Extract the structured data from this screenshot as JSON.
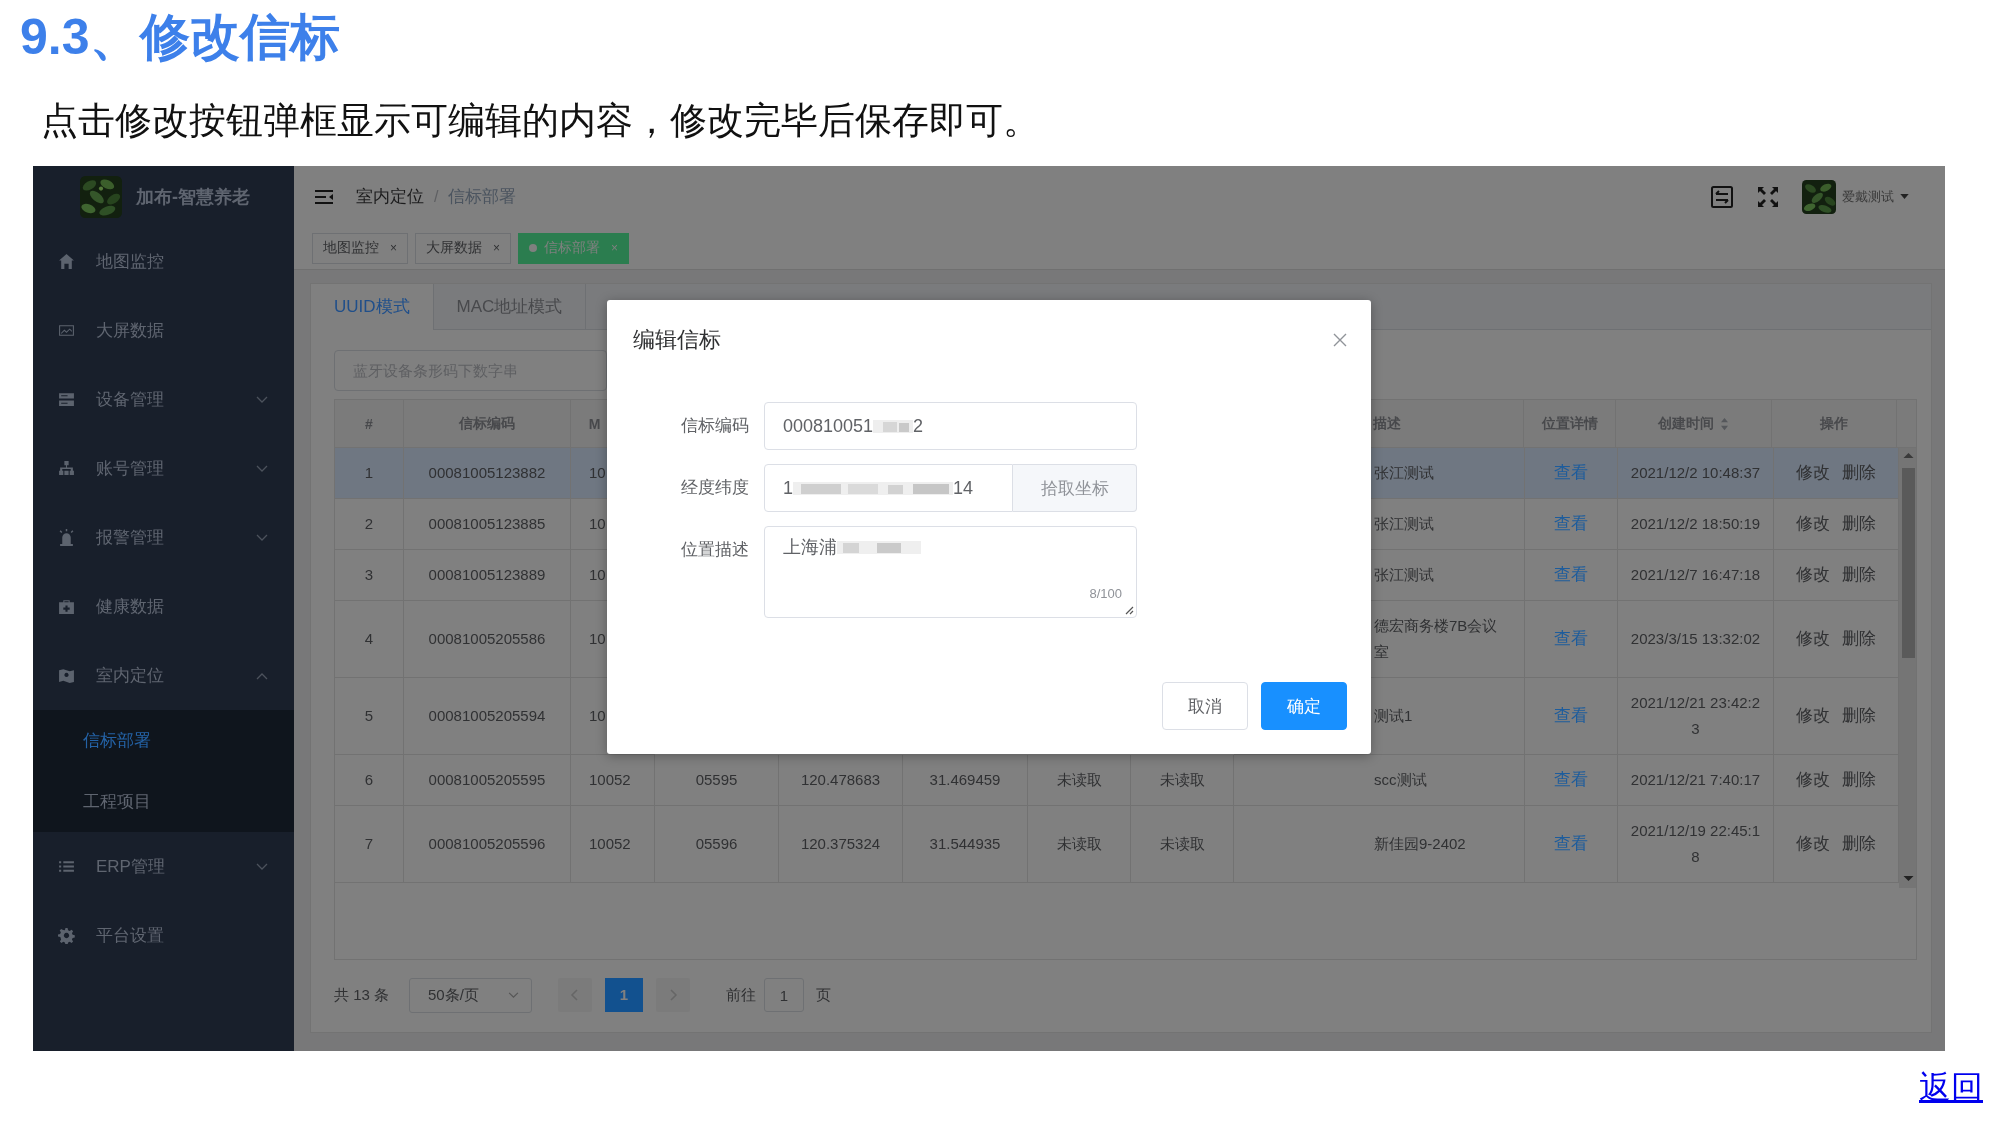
{
  "doc": {
    "heading": "9.3、修改信标",
    "intro": "点击修改按钮弹框显示可编辑的内容，修改完毕后保存即可。",
    "back_link": "返回"
  },
  "app": {
    "brand": "加布-智慧养老",
    "sidebar": {
      "items": [
        {
          "label": "地图监控"
        },
        {
          "label": "大屏数据"
        },
        {
          "label": "设备管理",
          "expanded": false
        },
        {
          "label": "账号管理",
          "expanded": false
        },
        {
          "label": "报警管理",
          "expanded": false
        },
        {
          "label": "健康数据"
        },
        {
          "label": "室内定位",
          "expanded": true,
          "children": [
            {
              "label": "信标部署",
              "selected": true
            },
            {
              "label": "工程项目",
              "selected": false
            }
          ]
        },
        {
          "label": "ERP管理",
          "expanded": false
        },
        {
          "label": "平台设置"
        }
      ]
    },
    "breadcrumb": [
      "室内定位",
      "信标部署"
    ],
    "breadcrumb_separator": "/",
    "user": {
      "name": "爱戴测试"
    },
    "tags": [
      {
        "label": "地图监控",
        "close": "×",
        "selected": false
      },
      {
        "label": "大屏数据",
        "close": "×",
        "selected": false
      },
      {
        "label": "信标部署",
        "close": "×",
        "selected": true
      }
    ],
    "tabs": [
      {
        "label": "UUID模式",
        "selected": true
      },
      {
        "label": "MAC地址模式",
        "selected": false
      }
    ],
    "search": {
      "placeholder": "蓝牙设备条形码下数字串"
    },
    "table": {
      "columns": [
        {
          "label": "#"
        },
        {
          "label": "信标编码"
        },
        {
          "label": "M"
        },
        {},
        {},
        {},
        {},
        {},
        {
          "label": "描述"
        },
        {
          "label": "位置详情"
        },
        {
          "label": "创建时间",
          "sortable": true
        },
        {
          "label": "操作"
        }
      ],
      "rows": [
        {
          "selected": true,
          "number": "1",
          "beacon_code": "00081005123882",
          "column_3": "10",
          "description": "张江测试",
          "detail_link": "查看",
          "created": "2021/12/2 10:48:37",
          "actions": [
            "修改",
            "删除"
          ]
        },
        {
          "selected": false,
          "number": "2",
          "beacon_code": "00081005123885",
          "column_3": "10",
          "description": "张江测试",
          "detail_link": "查看",
          "created": "2021/12/2 18:50:19",
          "actions": [
            "修改",
            "删除"
          ]
        },
        {
          "selected": false,
          "number": "3",
          "beacon_code": "00081005123889",
          "column_3": "10",
          "description": "张江测试",
          "detail_link": "查看",
          "created": "2021/12/7 16:47:18",
          "actions": [
            "修改",
            "删除"
          ]
        },
        {
          "selected": false,
          "number": "4",
          "beacon_code": "00081005205586",
          "column_3": "10",
          "description": "德宏商务楼7B会议室",
          "detail_link": "查看",
          "created": "2023/3/15 13:32:02",
          "actions": [
            "修改",
            "删除"
          ]
        },
        {
          "selected": false,
          "number": "5",
          "beacon_code": "00081005205594",
          "column_3": "10",
          "description": "测试1",
          "detail_link": "查看",
          "created": "2021/12/21 23:42:23",
          "actions": [
            "修改",
            "删除"
          ]
        },
        {
          "selected": false,
          "number": "6",
          "beacon_code": "00081005205595",
          "column_3": "10052",
          "column_4": "05595",
          "column_5": "120.478683",
          "column_6": "31.469459",
          "column_7": "未读取",
          "column_8": "未读取",
          "description": "scc测试",
          "detail_link": "查看",
          "created": "2021/12/21 7:40:17",
          "actions": [
            "修改",
            "删除"
          ]
        },
        {
          "selected": false,
          "number": "7",
          "beacon_code": "00081005205596",
          "column_3": "10052",
          "column_4": "05596",
          "column_5": "120.375324",
          "column_6": "31.544935",
          "column_7": "未读取",
          "column_8": "未读取",
          "description": "新佳园9-2402",
          "detail_link": "查看",
          "created": "2021/12/19 22:45:18",
          "actions": [
            "修改",
            "删除"
          ]
        }
      ]
    },
    "pagination": {
      "total": "共 13 条",
      "page_size": "50条/页",
      "pages": [
        {
          "label": "1",
          "selected": true
        }
      ],
      "goto_label": "前往",
      "goto_value": "1",
      "goto_suffix": "页"
    }
  },
  "dialog": {
    "title": "编辑信标",
    "fields": [
      {
        "kind": "input",
        "label": "信标编码",
        "value_start": "000810051",
        "redacted": true,
        "value_end": "2"
      },
      {
        "kind": "input_button",
        "label": "经度纬度",
        "value_start": "1",
        "redacted": true,
        "value_end": "14",
        "button": "拾取坐标"
      },
      {
        "kind": "textarea",
        "label": "位置描述",
        "value_start": "上海浦",
        "redacted": true,
        "counter": "8/100"
      }
    ],
    "buttons": [
      {
        "label": "取消",
        "kind": "default"
      },
      {
        "label": "确定",
        "kind": "primary"
      }
    ]
  }
}
